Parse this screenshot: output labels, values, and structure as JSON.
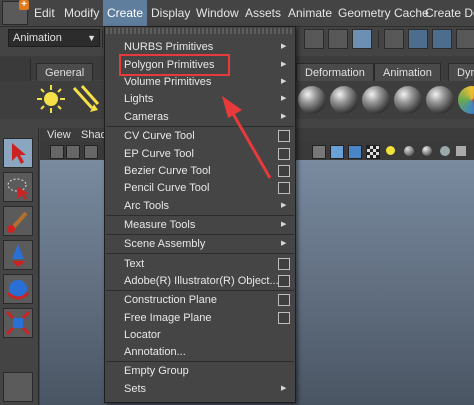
{
  "menubar": {
    "items": [
      {
        "label": "Edit"
      },
      {
        "label": "Modify"
      },
      {
        "label": "Create"
      },
      {
        "label": "Display"
      },
      {
        "label": "Window"
      },
      {
        "label": "Assets"
      },
      {
        "label": "Animate"
      },
      {
        "label": "Geometry Cache"
      },
      {
        "label": "Create Defo"
      }
    ],
    "active": "Create"
  },
  "toolbar": {
    "mode_select": "Animation"
  },
  "shelf": {
    "tabs": [
      {
        "label": "General"
      },
      {
        "label": "Deformation"
      },
      {
        "label": "Animation"
      },
      {
        "label": "Dyna"
      }
    ]
  },
  "viewport": {
    "menu": [
      {
        "label": "View"
      },
      {
        "label": "Shad"
      }
    ]
  },
  "create_menu": {
    "items": [
      {
        "label": "NURBS Primitives",
        "submenu": true
      },
      {
        "label": "Polygon Primitives",
        "submenu": true
      },
      {
        "label": "Volume Primitives",
        "submenu": true
      },
      {
        "label": "Lights",
        "submenu": true
      },
      {
        "label": "Cameras",
        "submenu": true
      },
      {
        "label": "CV Curve Tool",
        "option_box": true
      },
      {
        "label": "EP Curve Tool",
        "option_box": true
      },
      {
        "label": "Bezier Curve Tool",
        "option_box": true
      },
      {
        "label": "Pencil Curve Tool",
        "option_box": true
      },
      {
        "label": "Arc Tools",
        "submenu": true
      },
      {
        "label": "Measure Tools",
        "submenu": true
      },
      {
        "label": "Scene Assembly",
        "submenu": true
      },
      {
        "label": "Text",
        "option_box": true
      },
      {
        "label": "Adobe(R) Illustrator(R) Object...",
        "option_box": true
      },
      {
        "label": "Construction Plane",
        "option_box": true
      },
      {
        "label": "Free Image Plane",
        "option_box": true
      },
      {
        "label": "Locator"
      },
      {
        "label": "Annotation..."
      },
      {
        "label": "Empty Group"
      },
      {
        "label": "Sets",
        "submenu": true
      }
    ]
  },
  "annotation": {
    "highlight_color": "#e83a3a",
    "highlighted_item": "Polygon Primitives"
  },
  "colors": {
    "menu_active": "#5f7d9c",
    "background": "#444444"
  }
}
